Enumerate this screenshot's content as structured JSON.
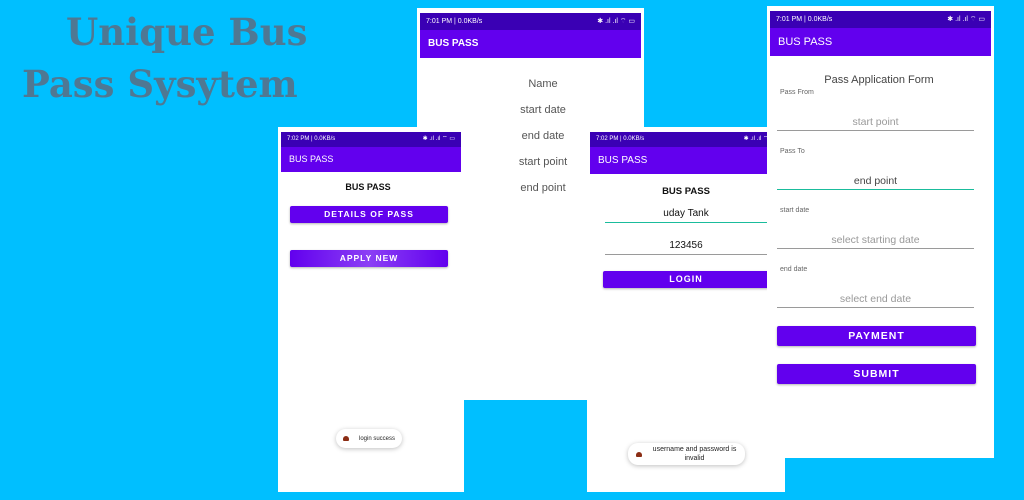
{
  "headline": {
    "line1": "Unique Bus",
    "line2": "Pass Sysytem"
  },
  "screens": {
    "details": {
      "status_time": "7:01 PM | 0.0KB/s",
      "status_icons": "✱ .ıl .ıl ⌔ ▭",
      "app_title": "BUS PASS",
      "labels": [
        "Name",
        "start date",
        "end date",
        "start point",
        "end point"
      ]
    },
    "home": {
      "status_time": "7:02 PM | 0.0KB/s",
      "status_icons": "✱ .ıl .ıl ⌔ ▭",
      "app_title": "BUS PASS",
      "heading": "BUS PASS",
      "details_button": "DETAILS OF PASS",
      "apply_button": "APPLY NEW",
      "toast": "login success"
    },
    "login": {
      "status_time": "7:02 PM | 0.0KB/s",
      "status_icons": "✱ .ıl .ıl ⌔ ▭",
      "app_title": "BUS PASS",
      "heading": "BUS PASS",
      "username_value": "uday Tank",
      "password_value": "123456",
      "login_button": "LOGIN",
      "toast": "username and password is invalid"
    },
    "apply": {
      "status_time": "7:01 PM | 0.0KB/s",
      "status_icons": "✱ .ıl .ıl ⌔ ▭",
      "app_title": "BUS PASS",
      "form_title": "Pass Application Form",
      "pass_from_label": "Pass From",
      "pass_from_placeholder": "start point",
      "pass_to_label": "Pass To",
      "pass_to_value": "end point",
      "start_date_label": "start date",
      "start_date_placeholder": "select starting date",
      "end_date_label": "end date",
      "end_date_placeholder": "select end date",
      "payment_button": "PAYMENT",
      "submit_button": "SUBMIT"
    }
  },
  "colors": {
    "background": "#00bfff",
    "primary": "#6200ee",
    "status_bar": "#3a00b4",
    "headline": "#4f7893"
  }
}
